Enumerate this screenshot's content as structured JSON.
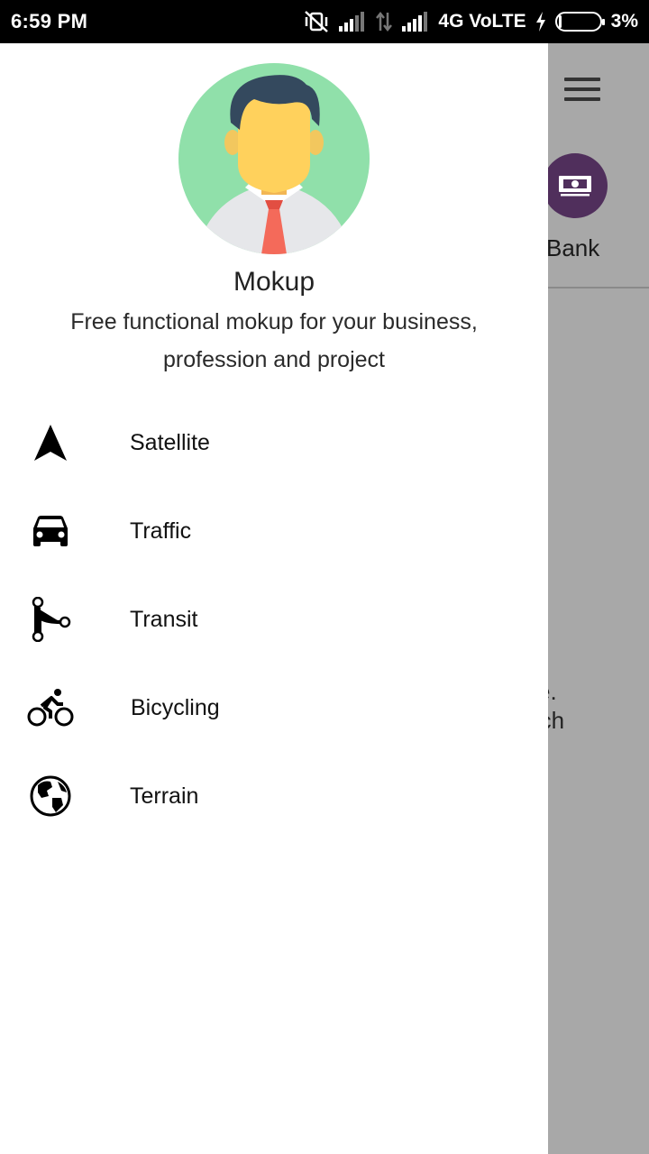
{
  "status_bar": {
    "time": "6:59 PM",
    "network": "4G VoLTE",
    "battery": "3%"
  },
  "background": {
    "bank_label": "Bank",
    "text_line1": "e.",
    "text_line2": "rch"
  },
  "drawer": {
    "profile": {
      "name": "Mokup",
      "description": "Free functional mokup for your business, profession and project"
    },
    "items": [
      {
        "label": "Satellite",
        "icon": "navigation-arrow-icon"
      },
      {
        "label": "Traffic",
        "icon": "car-icon"
      },
      {
        "label": "Transit",
        "icon": "route-icon"
      },
      {
        "label": "Bicycling",
        "icon": "bike-icon"
      },
      {
        "label": "Terrain",
        "icon": "globe-icon"
      }
    ]
  },
  "colors": {
    "drawer_bg": "#ffffff",
    "scrim": "#a8a8a8",
    "bank_circle": "#502f5c",
    "avatar_bg": "#90e0aa",
    "tie": "#f46a5a"
  }
}
